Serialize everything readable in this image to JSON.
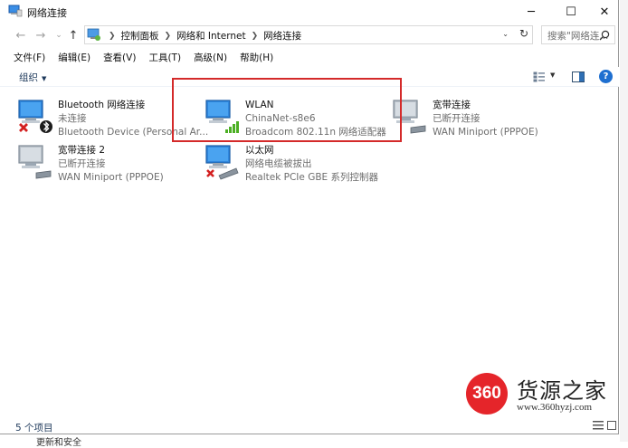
{
  "window": {
    "title": "网络连接"
  },
  "title_buttons": {
    "minimize": "─",
    "maximize": "☐",
    "close": "✕"
  },
  "nav": {
    "back": "←",
    "forward": "→",
    "dropdown": "⌄",
    "up": "↑"
  },
  "address": {
    "crumbs": [
      "控制面板",
      "网络和 Internet",
      "网络连接"
    ],
    "refresh": "↻",
    "dropdown": "⌄"
  },
  "search": {
    "placeholder": "搜索\"网络连..."
  },
  "menu": [
    "文件(F)",
    "编辑(E)",
    "查看(V)",
    "工具(T)",
    "高级(N)",
    "帮助(H)"
  ],
  "command_bar": {
    "organize": "组织",
    "help": "?"
  },
  "connections": [
    {
      "name": "Bluetooth 网络连接",
      "status": "未连接",
      "device": "Bluetooth Device (Personal Ar...",
      "icon": "bluetooth-network-icon",
      "badge": "disconnected-x"
    },
    {
      "name": "WLAN",
      "status": "ChinaNet-s8e6",
      "device": "Broadcom 802.11n 网络适配器",
      "icon": "wifi-network-icon",
      "badge": "signal-bars"
    },
    {
      "name": "宽带连接",
      "status": "已断开连接",
      "device": "WAN Miniport (PPPOE)",
      "icon": "broadband-icon",
      "badge": "none"
    },
    {
      "name": "宽带连接 2",
      "status": "已断开连接",
      "device": "WAN Miniport (PPPOE)",
      "icon": "broadband-icon",
      "badge": "none"
    },
    {
      "name": "以太网",
      "status": "网络电缆被拔出",
      "device": "Realtek PCIe GBE 系列控制器",
      "icon": "ethernet-icon",
      "badge": "disconnected-x"
    }
  ],
  "status_bar": {
    "count": "5 个项目"
  },
  "background_peek": {
    "text": "更新和安全"
  },
  "watermark": {
    "logo": "360",
    "title": "货源之家",
    "url": "www.360hyzj.com"
  },
  "colors": {
    "highlight": "#d42a2a",
    "link_blue": "#1e395b",
    "wifi_green": "#4caf24",
    "error_red": "#d32020"
  }
}
